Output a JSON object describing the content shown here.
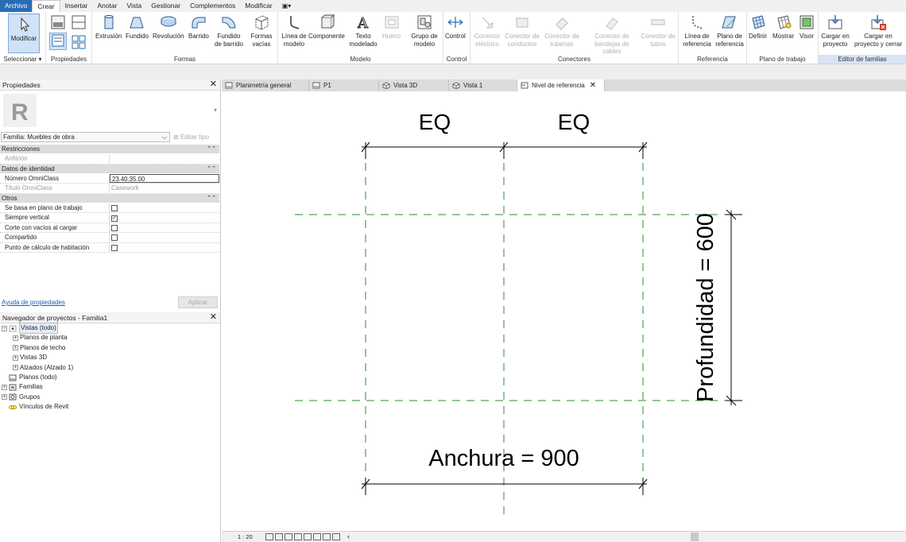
{
  "menu": {
    "items": [
      "Archivo",
      "Crear",
      "Insertar",
      "Anotar",
      "Vista",
      "Gestionar",
      "Complementos",
      "Modificar",
      "▣▾"
    ],
    "active": "Crear"
  },
  "ribbon": {
    "modificar": "Modificar",
    "seleccionar": "Seleccionar ▾",
    "propiedades": "Propiedades",
    "formas": {
      "label": "Formas",
      "buttons": [
        "Extrusión",
        "Fundido",
        "Revolución",
        "Barrido",
        "Fundido de barrido",
        "Formas vacías"
      ]
    },
    "modelo": {
      "label": "Modelo",
      "buttons": [
        "Línea de modelo",
        "Componente",
        "Texto modelado",
        "Hueco",
        "Grupo de modelo"
      ]
    },
    "control": {
      "label": "Control",
      "button": "Control"
    },
    "conectores": {
      "label": "Conectores",
      "buttons": [
        "Conector eléctrico",
        "Conector de conductos",
        "Conector de tuberías",
        "Conector de bandejas de cables",
        "Conector de tubos"
      ]
    },
    "referencia": {
      "label": "Referencia",
      "buttons": [
        "Línea de referencia",
        "Plano de referencia"
      ]
    },
    "plano_trabajo": {
      "label": "Plano de trabajo",
      "buttons": [
        "Definir",
        "Mostrar",
        "Visor"
      ]
    },
    "editor": {
      "label": "Editor de familias",
      "buttons": [
        "Cargar en proyecto",
        "Cargar en proyecto y cerrar"
      ]
    }
  },
  "properties": {
    "title": "Propiedades",
    "family_selector": "Familia: Muebles de obra",
    "edit_type": "Editar tipo",
    "categories": {
      "restricciones": "Restricciones",
      "identidad": "Datos de identidad",
      "otros": "Otros"
    },
    "rows": {
      "anfitrion": "Anfitrión",
      "omni_num_k": "Número OmniClass",
      "omni_num_v": "23.40.35.00",
      "omni_tit_k": "Título OmniClass",
      "omni_tit_v": "Casework",
      "plano": "Se basa en plano de trabajo",
      "vertical": "Siempre vertical",
      "corte": "Corte con vacíos al cargar",
      "compartido": "Compartido",
      "habitacion": "Punto de cálculo de habitación"
    },
    "help": "Ayuda de propiedades",
    "apply": "Aplicar"
  },
  "browser": {
    "title": "Navegador de proyectos - Familia1",
    "nodes": [
      "Vistas (todo)",
      "Planos de planta",
      "Planos de techo",
      "Vistas 3D",
      "Alzados (Alzado 1)",
      "Planos (todo)",
      "Familias",
      "Grupos",
      "Vínculos de Revit"
    ]
  },
  "tabs": [
    "Planimetría general",
    "P1",
    "Vista 3D",
    "Vista 1",
    "Nivel de referencia"
  ],
  "canvas": {
    "eq_left": "EQ",
    "eq_right": "EQ",
    "width_label": "Anchura = 900",
    "depth_label": "Profundidad = 600"
  },
  "status": {
    "scale": "1 : 20",
    "arrow": "‹"
  },
  "colors": {
    "file_tab": "#2a6db5",
    "ref_plane": "#2e8b2e",
    "editor_group": "#d8e4f3"
  }
}
